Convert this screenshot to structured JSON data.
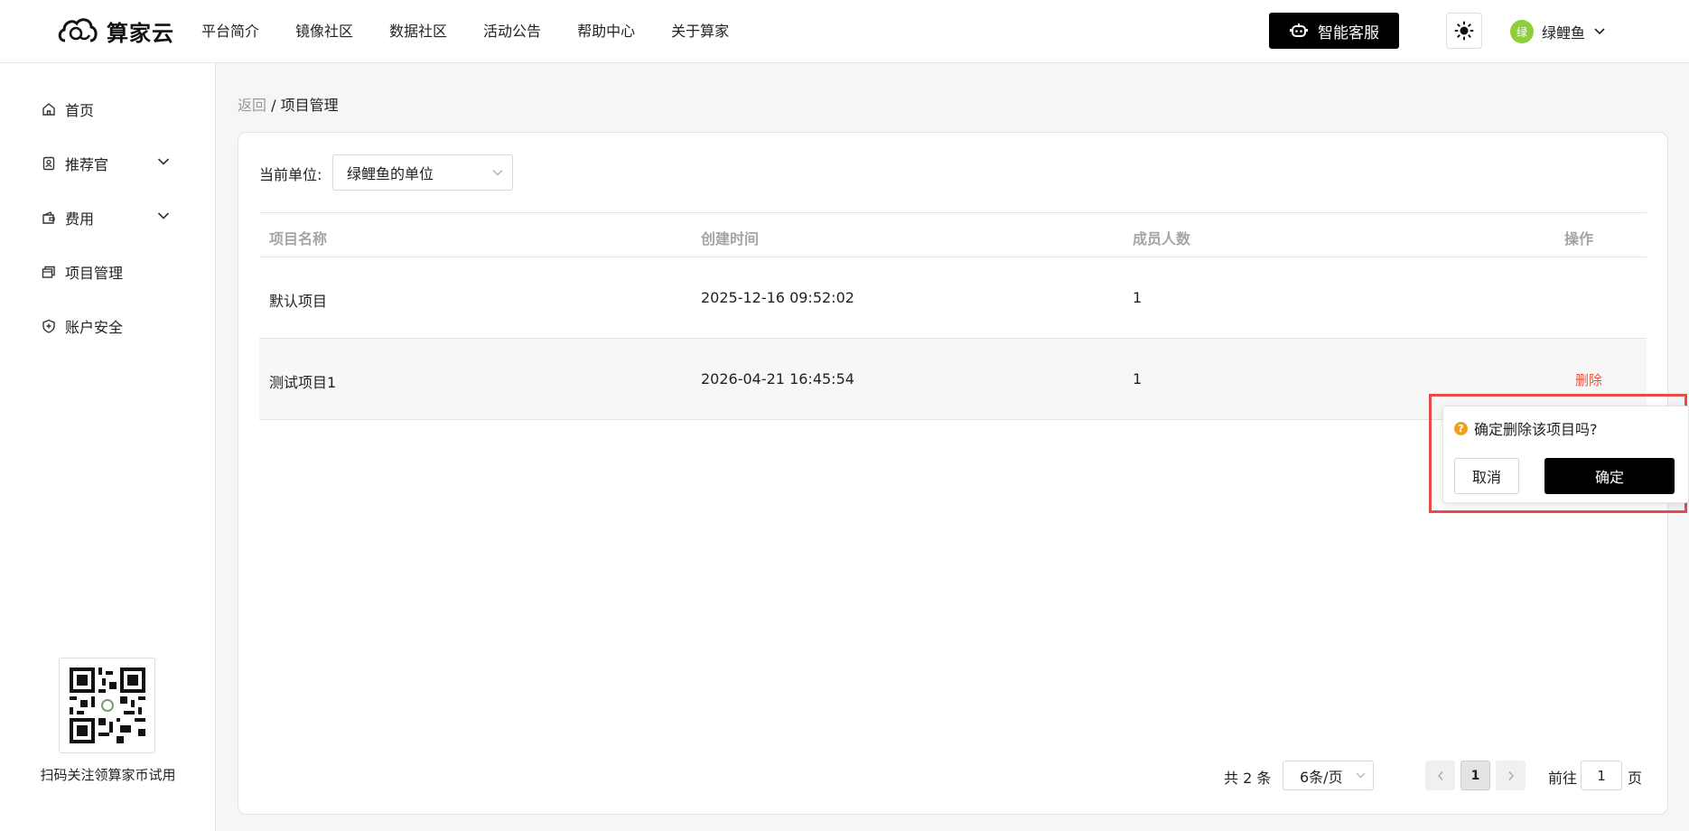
{
  "header": {
    "brand": "算家云",
    "nav": [
      "平台简介",
      "镜像社区",
      "数据社区",
      "活动公告",
      "帮助中心",
      "关于算家"
    ],
    "service_label": "智能客服",
    "user": {
      "avatar_text": "绿",
      "name": "绿鲤鱼"
    }
  },
  "sidebar": {
    "items": [
      {
        "label": "首页",
        "icon": "home-icon"
      },
      {
        "label": "推荐官",
        "icon": "badge-icon",
        "expandable": true
      },
      {
        "label": "费用",
        "icon": "wallet-icon",
        "expandable": true
      },
      {
        "label": "项目管理",
        "icon": "folders-icon"
      },
      {
        "label": "账户安全",
        "icon": "shield-icon"
      }
    ],
    "qr_caption": "扫码关注领算家币试用"
  },
  "breadcrumb": {
    "back": "返回",
    "separator": " / ",
    "current": "项目管理"
  },
  "unit": {
    "label": "当前单位:",
    "value": "绿鲤鱼的单位"
  },
  "table": {
    "columns": [
      "项目名称",
      "创建时间",
      "成员人数",
      "操作"
    ],
    "rows": [
      {
        "name": "默认项目",
        "created": "2025-12-16 09:52:02",
        "members": "1",
        "action": ""
      },
      {
        "name": "测试项目1",
        "created": "2026-04-21 16:45:54",
        "members": "1",
        "action": "删除"
      }
    ]
  },
  "popconfirm": {
    "message": "确定删除该项目吗?",
    "cancel": "取消",
    "confirm": "确定"
  },
  "pagination": {
    "total": "共 2 条",
    "page_size": "6条/页",
    "current": "1",
    "goto_prefix": "前往",
    "goto_value": "1",
    "goto_suffix": "页"
  },
  "colors": {
    "accent": "#000000",
    "danger": "#e8553f",
    "avatar": "#8ccf3a",
    "warning": "#f0a020",
    "highlight": "#e94b4b"
  }
}
